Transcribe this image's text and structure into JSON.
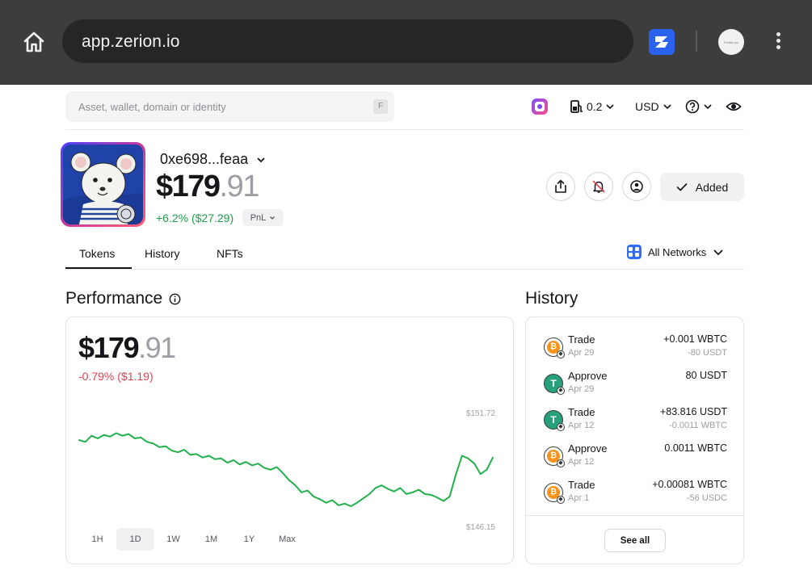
{
  "browser": {
    "url": "app.zerion.io",
    "profile_text": "Profile pic"
  },
  "topbar": {
    "search_placeholder": "Asset, wallet, domain or identity",
    "search_shortcut": "F",
    "gas_value": "0.2",
    "currency": "USD"
  },
  "wallet": {
    "address": "0xe698...feaa",
    "balance_whole": "$179",
    "balance_decimal": ".91",
    "change": "+6.2% ($27.29)",
    "pnl_label": "PnL",
    "added_label": "Added"
  },
  "tabs": [
    {
      "label": "Tokens",
      "active": true
    },
    {
      "label": "History",
      "active": false
    },
    {
      "label": "NFTs",
      "active": false
    }
  ],
  "networks_label": "All Networks",
  "performance": {
    "title": "Performance",
    "balance_whole": "$179",
    "balance_decimal": ".91",
    "change": "-0.79% ($1.19)",
    "max_label": "$151.72",
    "min_label": "$146.15",
    "ranges": [
      "1H",
      "1D",
      "1W",
      "1M",
      "1Y",
      "Max"
    ],
    "active_range": "1D"
  },
  "chart_data": {
    "type": "line",
    "title": "",
    "xlabel": "",
    "ylabel": "",
    "ylim": [
      146.15,
      151.72
    ],
    "color": "#22b14c",
    "grid": false,
    "values": [
      150.6,
      150.5,
      150.85,
      150.7,
      150.9,
      150.8,
      151.0,
      150.85,
      150.95,
      150.7,
      150.75,
      150.5,
      150.4,
      150.2,
      150.25,
      150.0,
      149.9,
      150.05,
      149.75,
      149.8,
      149.6,
      149.7,
      149.5,
      149.55,
      149.3,
      149.45,
      149.2,
      149.35,
      149.15,
      149.25,
      149.0,
      148.9,
      149.05,
      148.7,
      148.3,
      148.0,
      147.6,
      147.7,
      147.35,
      147.2,
      147.0,
      147.15,
      146.85,
      146.95,
      146.8,
      147.0,
      147.25,
      147.5,
      147.85,
      148.0,
      147.8,
      147.65,
      147.85,
      147.5,
      147.6,
      147.75,
      147.5,
      147.45,
      147.3,
      147.1,
      147.35,
      148.6,
      149.7,
      149.55,
      149.25,
      148.65,
      148.9,
      149.6
    ]
  },
  "history": {
    "title": "History",
    "items": [
      {
        "type": "Trade",
        "date": "Apr 29",
        "amount": "+0.001 WBTC",
        "sub": "-80 USDT",
        "coin": "btc"
      },
      {
        "type": "Approve",
        "date": "Apr 29",
        "amount": "80 USDT",
        "sub": "",
        "coin": "usdt"
      },
      {
        "type": "Trade",
        "date": "Apr 12",
        "amount": "+83.816 USDT",
        "sub": "-0.0011 WBTC",
        "coin": "usdt"
      },
      {
        "type": "Approve",
        "date": "Apr 12",
        "amount": "0.0011 WBTC",
        "sub": "",
        "coin": "btc"
      },
      {
        "type": "Trade",
        "date": "Apr 1",
        "amount": "+0.00081 WBTC",
        "sub": "-56 USDC",
        "coin": "btc"
      }
    ],
    "see_all_label": "See all"
  }
}
